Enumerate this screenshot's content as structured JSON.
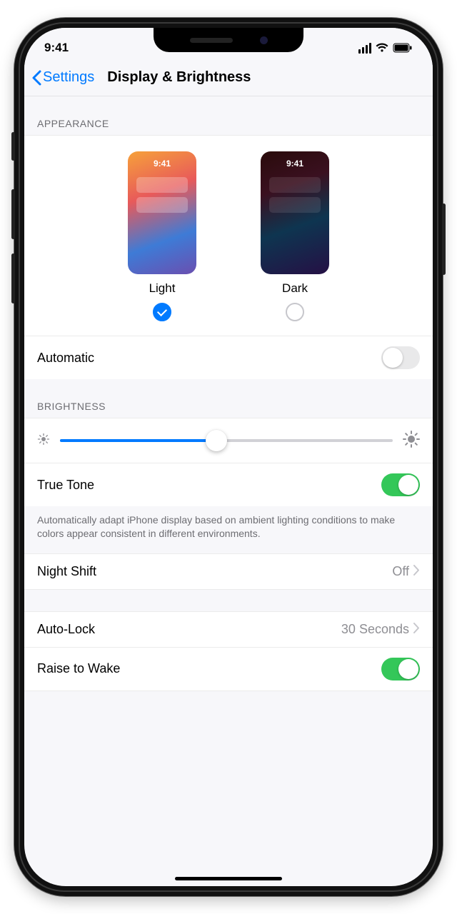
{
  "status": {
    "time": "9:41"
  },
  "nav": {
    "back": "Settings",
    "title": "Display & Brightness"
  },
  "appearance": {
    "header": "APPEARANCE",
    "preview_time": "9:41",
    "light_label": "Light",
    "dark_label": "Dark",
    "automatic_label": "Automatic"
  },
  "brightness": {
    "header": "BRIGHTNESS",
    "true_tone_label": "True Tone",
    "true_tone_note": "Automatically adapt iPhone display based on ambient lighting conditions to make colors appear consistent in different environments."
  },
  "night_shift": {
    "label": "Night Shift",
    "value": "Off"
  },
  "auto_lock": {
    "label": "Auto-Lock",
    "value": "30 Seconds"
  },
  "raise_to_wake": {
    "label": "Raise to Wake"
  }
}
